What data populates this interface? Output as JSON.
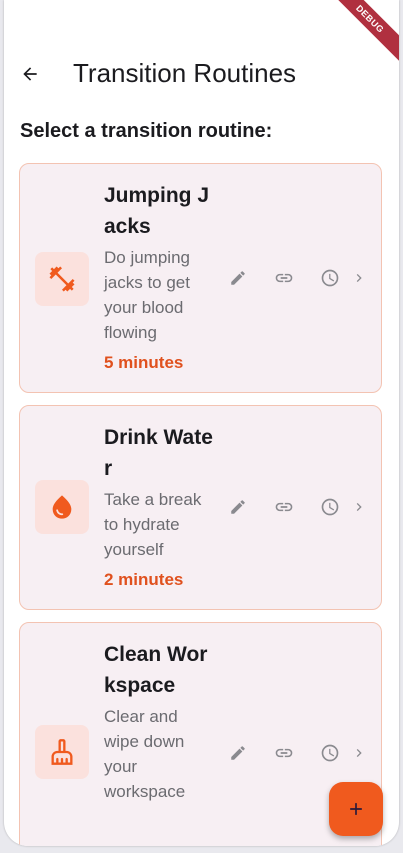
{
  "debug_banner": "DEBUG",
  "appbar": {
    "title": "Transition Routines"
  },
  "heading": "Select a transition routine:",
  "routines": [
    {
      "title": "Jumping Jacks",
      "description": "Do jumping jacks to get your blood flowing",
      "duration": "5 minutes",
      "icon": "dumbbell-icon"
    },
    {
      "title": "Drink Water",
      "description": "Take a break to hydrate yourself",
      "duration": "2 minutes",
      "icon": "water-drop-icon"
    },
    {
      "title": "Clean Workspace",
      "description": "Clear and wipe down your workspace",
      "duration": "",
      "icon": "broom-icon"
    }
  ],
  "fab": {
    "label": "+"
  },
  "colors": {
    "accent": "#f05a1e",
    "card_bg": "#f7eff3",
    "card_border": "#f3c3b2",
    "duration": "#e0511e"
  }
}
